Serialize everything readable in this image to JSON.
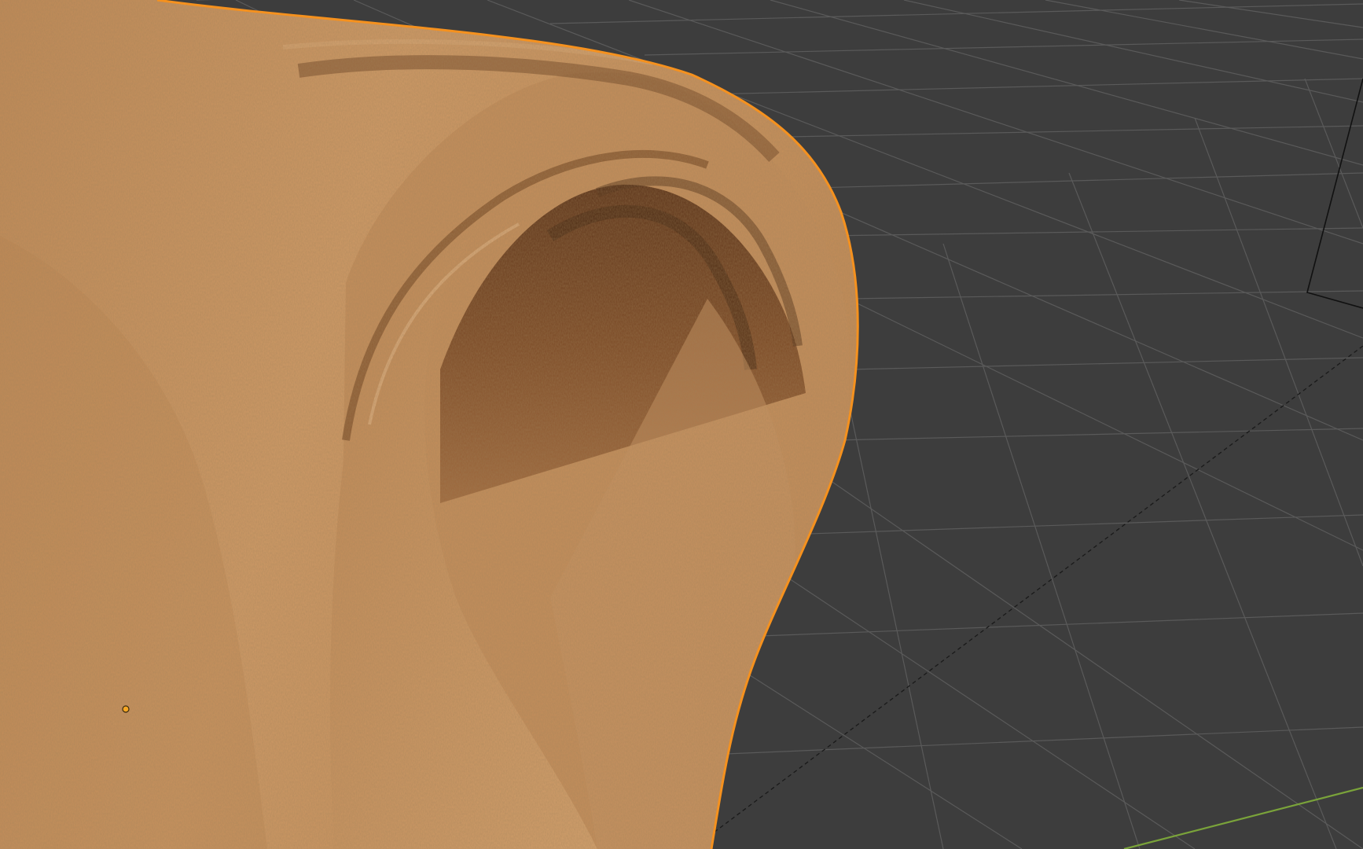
{
  "viewport": {
    "background_color": "#3d3d3d",
    "grid_color": "#5a5a5a",
    "x_axis_color": "#7aa33a",
    "selection_outline_color": "#f5911e",
    "origin_dot_color": "#f5a623"
  },
  "cloth_object": {
    "base_color": "#c8935e",
    "highlight_color": "#d9a877",
    "shadow_color": "#6b3e1c",
    "selected": true
  },
  "camera_object": {
    "wire_color": "#111111"
  }
}
